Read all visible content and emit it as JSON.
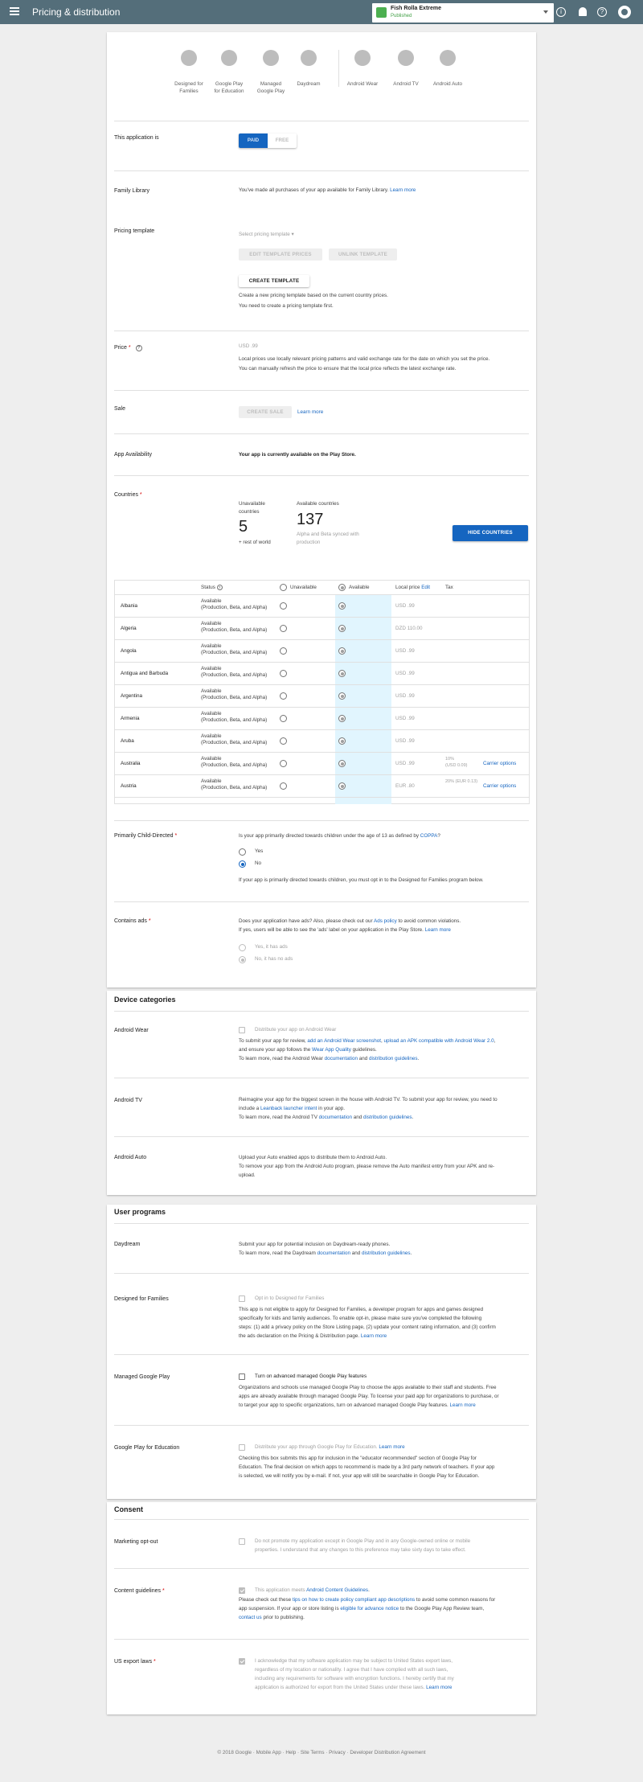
{
  "header": {
    "title": "Pricing & distribution",
    "app_name": "Fish Rolla Extreme",
    "app_status": "Published"
  },
  "device_types": [
    {
      "label": "Designed for\nFamilies"
    },
    {
      "label": "Google Play\nfor Education"
    },
    {
      "label": "Managed\nGoogle Play"
    },
    {
      "label": "Daydream"
    },
    {
      "label": "Android Wear"
    },
    {
      "label": "Android TV"
    },
    {
      "label": "Android Auto"
    }
  ],
  "paid_free": {
    "label": "This application is",
    "paid": "PAID",
    "free": "FREE"
  },
  "family_library": {
    "label": "Family Library",
    "text": "You've made all purchases of your app available for Family Library.",
    "link": "Learn more"
  },
  "pricing_template": {
    "label": "Pricing template",
    "select_placeholder": "Select pricing template",
    "edit_btn": "EDIT TEMPLATE PRICES",
    "unlink_btn": "UNLINK TEMPLATE",
    "create_btn": "CREATE TEMPLATE",
    "note1": "Create a new pricing template based on the current country prices.",
    "note2": "You need to create a pricing template first."
  },
  "price": {
    "label": "Price",
    "required": "*",
    "value": "USD .99",
    "note1": "Local prices use locally relevant pricing patterns and valid exchange rate for the date on which you set the price.",
    "note2": "You can manually refresh the price to ensure that the local price reflects the latest exchange rate."
  },
  "sale": {
    "label": "Sale",
    "btn": "CREATE SALE",
    "link": "Learn more"
  },
  "availability": {
    "label": "App Availability",
    "text": "Your app is currently available on the Play Store."
  },
  "countries": {
    "label": "Countries",
    "required": "*",
    "unavail_label": "Unavailable\ncountries",
    "unavail_count": "5",
    "unavail_sub": "+ rest of world",
    "avail_label": "Available countries",
    "avail_count": "137",
    "avail_sub": "Alpha and Beta synced with\nproduction",
    "hide_btn": "HIDE COUNTRIES"
  },
  "table": {
    "headers": {
      "status": "Status",
      "unavailable": "Unavailable",
      "available": "Available",
      "local_price": "Local price",
      "edit": "Edit",
      "tax": "Tax"
    },
    "rows": [
      {
        "country": "Albania",
        "status": "Available\n(Production, Beta, and Alpha)",
        "price": "USD .99",
        "tax": "",
        "carrier": ""
      },
      {
        "country": "Algeria",
        "status": "Available\n(Production, Beta, and Alpha)",
        "price": "DZD 110.00",
        "tax": "",
        "carrier": ""
      },
      {
        "country": "Angola",
        "status": "Available\n(Production, Beta, and Alpha)",
        "price": "USD .99",
        "tax": "",
        "carrier": ""
      },
      {
        "country": "Antigua and Barbuda",
        "status": "Available\n(Production, Beta, and Alpha)",
        "price": "USD .99",
        "tax": "",
        "carrier": ""
      },
      {
        "country": "Argentina",
        "status": "Available\n(Production, Beta, and Alpha)",
        "price": "USD .99",
        "tax": "",
        "carrier": ""
      },
      {
        "country": "Armenia",
        "status": "Available\n(Production, Beta, and Alpha)",
        "price": "USD .99",
        "tax": "",
        "carrier": ""
      },
      {
        "country": "Aruba",
        "status": "Available\n(Production, Beta, and Alpha)",
        "price": "USD .99",
        "tax": "",
        "carrier": ""
      },
      {
        "country": "Australia",
        "status": "Available\n(Production, Beta, and Alpha)",
        "price": "USD .99",
        "tax": "10%\n(USD 0.09)",
        "carrier": "Carrier options"
      },
      {
        "country": "Austria",
        "status": "Available\n(Production, Beta, and Alpha)",
        "price": "EUR .80",
        "tax": "20% (EUR 0.13)",
        "carrier": "Carrier options"
      }
    ]
  },
  "child_directed": {
    "label": "Primarily Child-Directed",
    "required": "*",
    "question": "Is your app primarily directed towards children under the age of 13 as defined by",
    "coppa": "COPPA",
    "qmark": "?",
    "yes": "Yes",
    "no": "No",
    "note": "If your app is primarily directed towards children, you must opt in to the Designed for Families program below."
  },
  "contains_ads": {
    "label": "Contains ads",
    "required": "*",
    "line1a": "Does your application have ads? Also, please check out our",
    "line1_link": "Ads policy",
    "line1b": "to avoid common violations.",
    "line2": "If yes, users will be able to see the 'ads' label on your application in the Play Store.",
    "line2_link": "Learn more",
    "yes": "Yes, it has ads",
    "no": "No, it has no ads"
  },
  "device_categories": {
    "title": "Device categories",
    "wear": {
      "label": "Android Wear",
      "checkbox": "Distribute your app on Android Wear",
      "l1a": "To submit your app for review,",
      "l1_link1": "add an Android Wear screenshot",
      "l1b": ",",
      "l1_link2": "upload an APK compatible with Android Wear 2.0",
      "l1c": ",",
      "l2a": "and ensure your app follows the",
      "l2_link": "Wear App Quality",
      "l2b": "guidelines.",
      "l3a": "To learn more, read the Android Wear",
      "l3_link1": "documentation",
      "l3b": "and",
      "l3_link2": "distribution guidelines",
      "l3c": "."
    },
    "tv": {
      "label": "Android TV",
      "l1": "Reimagine your app for the biggest screen in the house with Android TV. To submit your app for review, you need to",
      "l2a": "include a",
      "l2_link": "Leanback launcher intent",
      "l2b": "in your app.",
      "l3a": "To learn more, read the Android TV",
      "l3_link1": "documentation",
      "l3b": "and",
      "l3_link2": "distribution guidelines",
      "l3c": "."
    },
    "auto": {
      "label": "Android Auto",
      "l1": "Upload your Auto enabled apps to distribute them to Android Auto.",
      "l2": "To remove your app from the Android Auto program, please remove the Auto manifest entry from your APK and re-",
      "l3": "upload."
    }
  },
  "user_programs": {
    "title": "User programs",
    "daydream": {
      "label": "Daydream",
      "l1": "Submit your app for potential inclusion on Daydream-ready phones.",
      "l2a": "To learn more, read the Daydream",
      "l2_link1": "documentation",
      "l2b": "and",
      "l2_link2": "distribution guidelines",
      "l2c": "."
    },
    "families": {
      "label": "Designed for Families",
      "checkbox": "Opt in to Designed for Families",
      "l1": "This app is not eligible to apply for Designed for Families, a developer program for apps and games designed",
      "l2": "specifically for kids and family audiences. To enable opt-in, please make sure you've completed the following",
      "l3": "steps: (1) add a privacy policy on the Store Listing page, (2) update your content rating information, and (3) confirm",
      "l4a": "the ads declaration on the Pricing & Distribution page.",
      "l4_link": "Learn more"
    },
    "managed": {
      "label": "Managed Google Play",
      "checkbox": "Turn on advanced managed Google Play features",
      "l1": "Organizations and schools use managed Google Play to choose the apps available to their staff and students. Free",
      "l2": "apps are already available through managed Google Play. To license your paid app for organizations to purchase, or",
      "l3a": "to target your app to specific organizations, turn on advanced managed Google Play features.",
      "l3_link": "Learn more"
    },
    "education": {
      "label": "Google Play for Education",
      "checkbox": "Distribute your app through Google Play for Education.",
      "checkbox_link": "Learn more",
      "l1": "Checking this box submits this app for inclusion in the \"educator recommended\" section of Google Play for",
      "l2": "Education. The final decision on which apps to recommend is made by a 3rd party network of teachers. If your app",
      "l3": "is selected, we will notify you by e-mail. If not, your app will still be searchable in Google Play for Education."
    }
  },
  "consent": {
    "title": "Consent",
    "marketing": {
      "label": "Marketing opt-out",
      "l1": "Do not promote my application except in Google Play and in any Google-owned online or mobile",
      "l2": "properties. I understand that any changes to this preference may take sixty days to take effect."
    },
    "guidelines": {
      "label": "Content guidelines",
      "required": "*",
      "checkbox": "This application meets",
      "checkbox_link": "Android Content Guidelines",
      "checkbox_end": ".",
      "l1a": "Please check out these",
      "l1_link": "tips on how to create policy compliant app descriptions",
      "l1b": "to avoid some common reasons for",
      "l2a": "app suspension. If your app or store listing is",
      "l2_link": "eligible for advance notice",
      "l2b": "to the Google Play App Review team,",
      "l3_link": "contact us",
      "l3b": "prior to publishing."
    },
    "export": {
      "label": "US export laws",
      "required": "*",
      "l1": "I acknowledge that my software application may be subject to United States export laws,",
      "l2": "regardless of my location or nationality. I agree that I have complied with all such laws,",
      "l3": "including any requirements for software with encryption functions. I hereby certify that my",
      "l4a": "application is authorized for export from the United States under these laws.",
      "l4_link": "Learn more"
    }
  },
  "footer": {
    "text": "© 2018 Google · Mobile App · Help · Site Terms · Privacy · Developer Distribution Agreement"
  },
  "colors": {
    "topbar": "#546e7a",
    "primary": "#1565c0",
    "required": "#d50000",
    "available_col": "#e1f5fe"
  }
}
